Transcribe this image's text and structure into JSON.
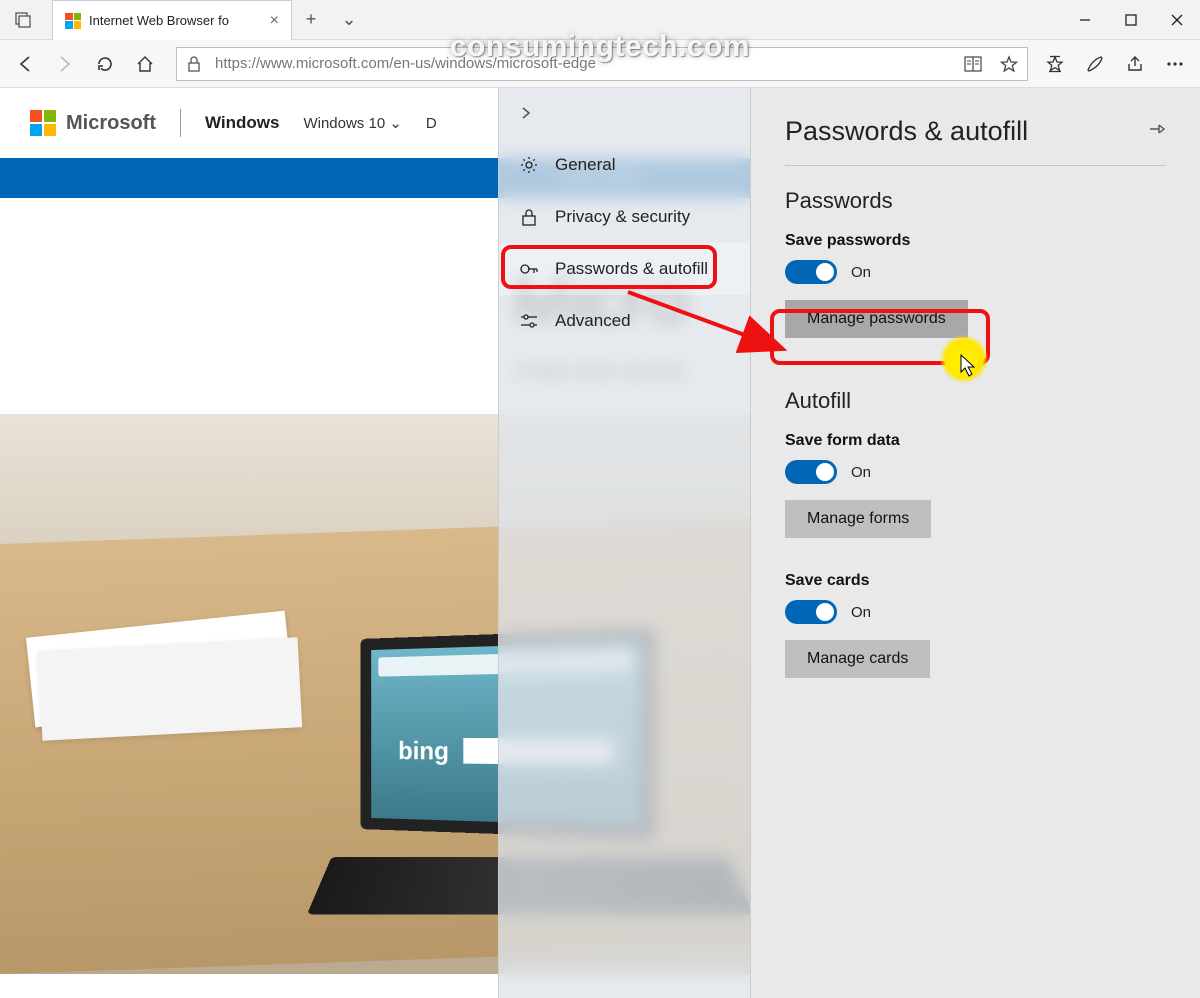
{
  "watermark": "consumingtech.com",
  "titlebar": {
    "tab_title": "Internet Web Browser fo",
    "tab_close": "×",
    "new_tab": "+",
    "tab_dropdown": "⌄"
  },
  "navbar": {
    "url": "https://www.microsoft.com/en-us/windows/microsoft-edge"
  },
  "page": {
    "ms_brand": "Microsoft",
    "section": "Windows",
    "dropdown": "Windows 10",
    "devices": "D",
    "promo": "Shop Windo",
    "hero_title": "Micro",
    "hero_sub": "A fast and secure",
    "bing": "bing"
  },
  "settings_sidebar": {
    "items": [
      {
        "icon": "gear",
        "label": "General"
      },
      {
        "icon": "lock",
        "label": "Privacy & security"
      },
      {
        "icon": "key",
        "label": "Passwords & autofill"
      },
      {
        "icon": "slider",
        "label": "Advanced"
      }
    ]
  },
  "panel": {
    "title": "Passwords & autofill",
    "section_passwords": "Passwords",
    "save_passwords": "Save passwords",
    "on": "On",
    "manage_passwords": "Manage passwords",
    "section_autofill": "Autofill",
    "save_form": "Save form data",
    "manage_forms": "Manage forms",
    "save_cards": "Save cards",
    "manage_cards": "Manage cards"
  }
}
